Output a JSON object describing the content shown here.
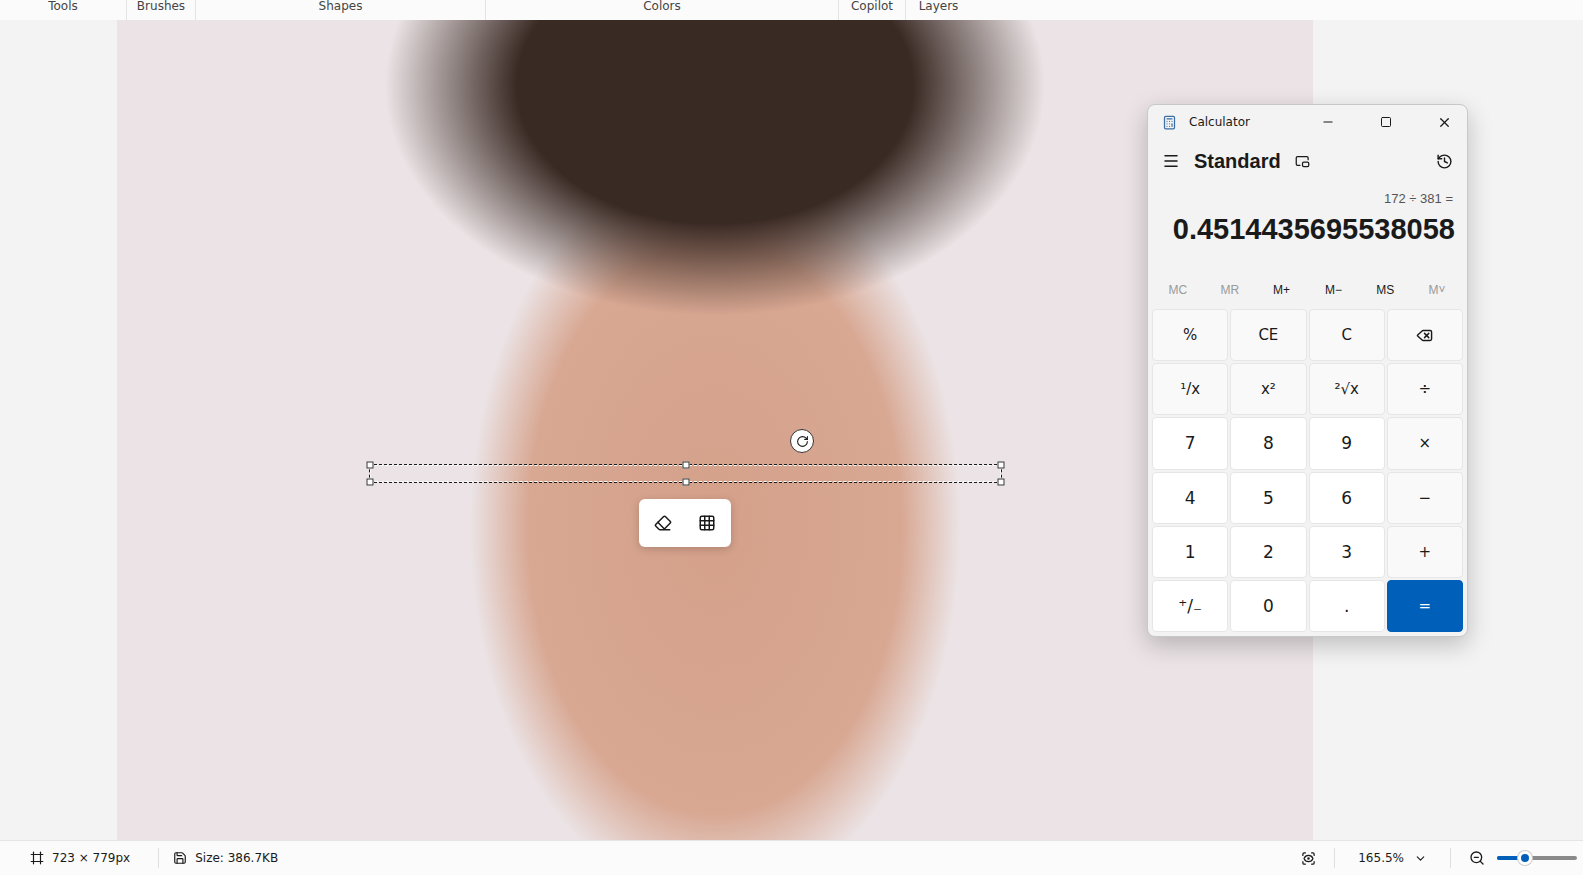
{
  "toolbar": {
    "groups": [
      {
        "label": "Tools"
      },
      {
        "label": "Brushes"
      },
      {
        "label": "Shapes"
      },
      {
        "label": "Colors"
      },
      {
        "label": "Copilot"
      },
      {
        "label": "Layers"
      }
    ]
  },
  "calculator": {
    "title": "Calculator",
    "mode": "Standard",
    "expression": "172 ÷ 381 =",
    "result": "0.4514435695538058",
    "memory": [
      {
        "label": "MC",
        "disabled": true
      },
      {
        "label": "MR",
        "disabled": true
      },
      {
        "label": "M+",
        "disabled": false
      },
      {
        "label": "M−",
        "disabled": false
      },
      {
        "label": "MS",
        "disabled": false
      },
      {
        "label": "M˅",
        "disabled": true
      }
    ],
    "keys": [
      {
        "label": "%",
        "kind": "function"
      },
      {
        "label": "CE",
        "kind": "function"
      },
      {
        "label": "C",
        "kind": "function"
      },
      {
        "label": "",
        "kind": "backspace"
      },
      {
        "label": "¹/x",
        "kind": "function"
      },
      {
        "label": "x²",
        "kind": "function"
      },
      {
        "label": "²√x",
        "kind": "function"
      },
      {
        "label": "÷",
        "kind": "function"
      },
      {
        "label": "7",
        "kind": "digit"
      },
      {
        "label": "8",
        "kind": "digit"
      },
      {
        "label": "9",
        "kind": "digit"
      },
      {
        "label": "×",
        "kind": "function"
      },
      {
        "label": "4",
        "kind": "digit"
      },
      {
        "label": "5",
        "kind": "digit"
      },
      {
        "label": "6",
        "kind": "digit"
      },
      {
        "label": "−",
        "kind": "function"
      },
      {
        "label": "1",
        "kind": "digit"
      },
      {
        "label": "2",
        "kind": "digit"
      },
      {
        "label": "3",
        "kind": "digit"
      },
      {
        "label": "+",
        "kind": "function"
      },
      {
        "label": "⁺/₋",
        "kind": "digit"
      },
      {
        "label": "0",
        "kind": "digit"
      },
      {
        "label": ".",
        "kind": "digit"
      },
      {
        "label": "=",
        "kind": "equals"
      }
    ]
  },
  "status_bar": {
    "dimensions": "723 × 779px",
    "size": "Size: 386.7KB",
    "zoom": "165.5%",
    "zoom_level": 0.35
  }
}
